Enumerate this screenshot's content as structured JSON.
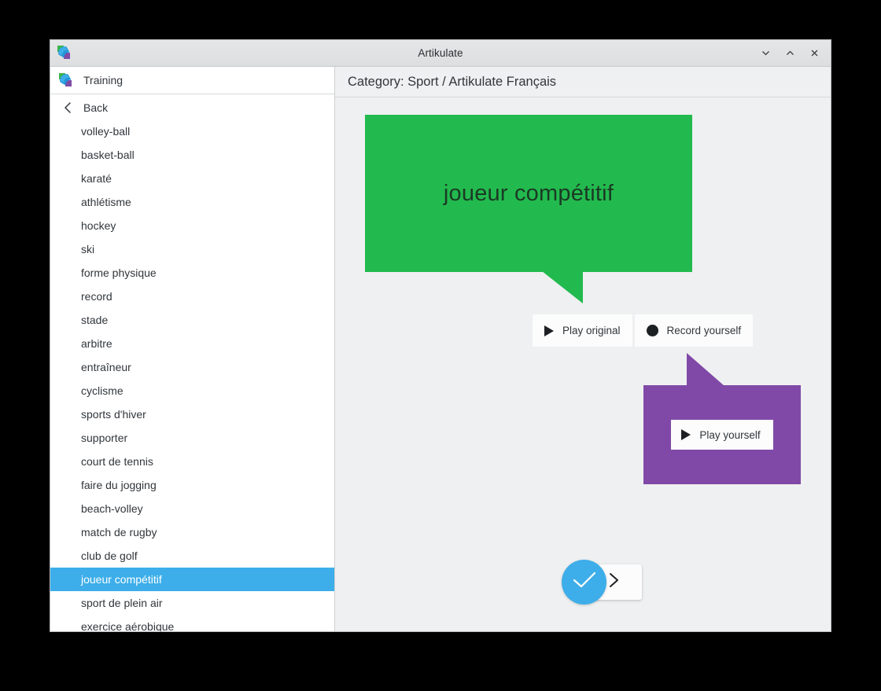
{
  "window": {
    "title": "Artikulate",
    "icon": "artikulate-icon",
    "controls": {
      "minimize": "minimize-icon",
      "maximize": "maximize-icon",
      "close": "close-icon"
    }
  },
  "sidebar": {
    "header": {
      "label": "Training",
      "icon": "artikulate-icon"
    },
    "back": {
      "label": "Back",
      "icon": "chevron-left-icon"
    },
    "items": [
      {
        "label": "volley-ball",
        "selected": false
      },
      {
        "label": "basket-ball",
        "selected": false
      },
      {
        "label": "karaté",
        "selected": false
      },
      {
        "label": "athlétisme",
        "selected": false
      },
      {
        "label": "hockey",
        "selected": false
      },
      {
        "label": "ski",
        "selected": false
      },
      {
        "label": "forme physique",
        "selected": false
      },
      {
        "label": "record",
        "selected": false
      },
      {
        "label": "stade",
        "selected": false
      },
      {
        "label": "arbitre",
        "selected": false
      },
      {
        "label": "entraîneur",
        "selected": false
      },
      {
        "label": "cyclisme",
        "selected": false
      },
      {
        "label": "sports d'hiver",
        "selected": false
      },
      {
        "label": "supporter",
        "selected": false
      },
      {
        "label": "court de tennis",
        "selected": false
      },
      {
        "label": "faire du jogging",
        "selected": false
      },
      {
        "label": "beach-volley",
        "selected": false
      },
      {
        "label": "match de rugby",
        "selected": false
      },
      {
        "label": "club de golf",
        "selected": false
      },
      {
        "label": "joueur compétitif",
        "selected": true
      },
      {
        "label": "sport de plein air",
        "selected": false
      },
      {
        "label": "exercice aérobique",
        "selected": false
      }
    ]
  },
  "content": {
    "category_header": "Category: Sport / Artikulate Français",
    "phrase": "joueur compétitif",
    "play_original_label": "Play original",
    "record_yourself_label": "Record yourself",
    "play_yourself_label": "Play yourself",
    "play_icon": "play-triangle-icon",
    "record_icon": "record-dot-icon"
  },
  "bottom_nav": {
    "check_icon": "checkmark-icon",
    "next_icon": "chevron-right-icon"
  },
  "colors": {
    "original_bubble": "#22ba4e",
    "user_bubble": "#8049a8",
    "selection": "#3daee9",
    "window_background": "#eff0f1",
    "sidebar_background": "#ffffff",
    "text": "#31363b"
  }
}
